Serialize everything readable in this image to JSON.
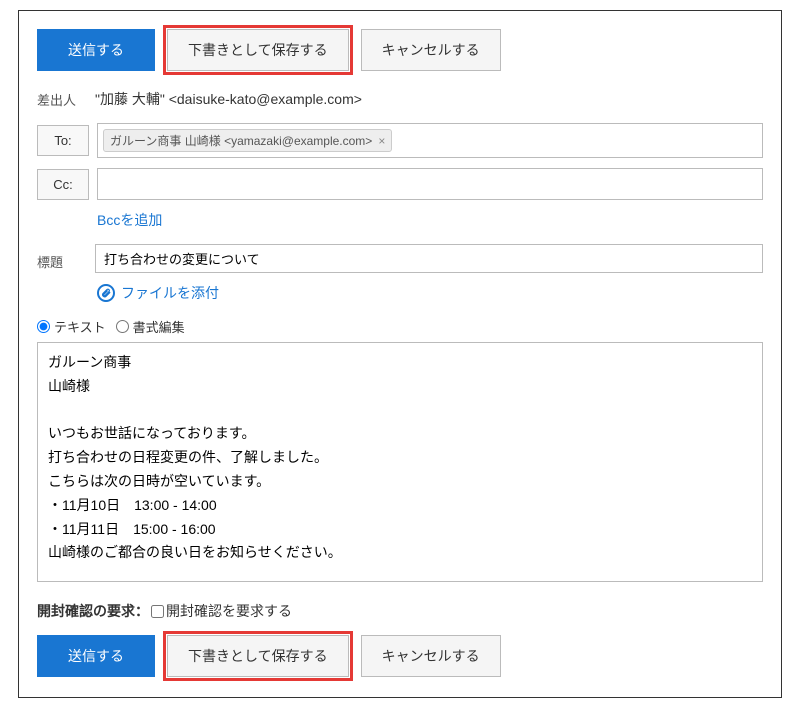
{
  "buttons": {
    "send": "送信する",
    "save_draft": "下書きとして保存する",
    "cancel": "キャンセルする"
  },
  "labels": {
    "from": "差出人",
    "to": "To:",
    "cc": "Cc:",
    "add_bcc": "Bccを追加",
    "subject": "標題",
    "attach_file": "ファイルを添付",
    "text_format": "テキスト",
    "rich_format": "書式編集",
    "receipt_label": "開封確認の要求：",
    "receipt_checkbox": "開封確認を要求する"
  },
  "from": {
    "display": "\"加藤 大輔\" <daisuke-kato@example.com>"
  },
  "to": {
    "chip": "ガルーン商事 山崎様 <yamazaki@example.com>"
  },
  "subject": {
    "value": "打ち合わせの変更について"
  },
  "body": {
    "text": "ガルーン商事\n山崎様\n\nいつもお世話になっております。\n打ち合わせの日程変更の件、了解しました。\nこちらは次の日時が空いています。\n・11月10日　13:00 - 14:00\n・11月11日　15:00 - 16:00\n山崎様のご都合の良い日をお知らせください。"
  }
}
